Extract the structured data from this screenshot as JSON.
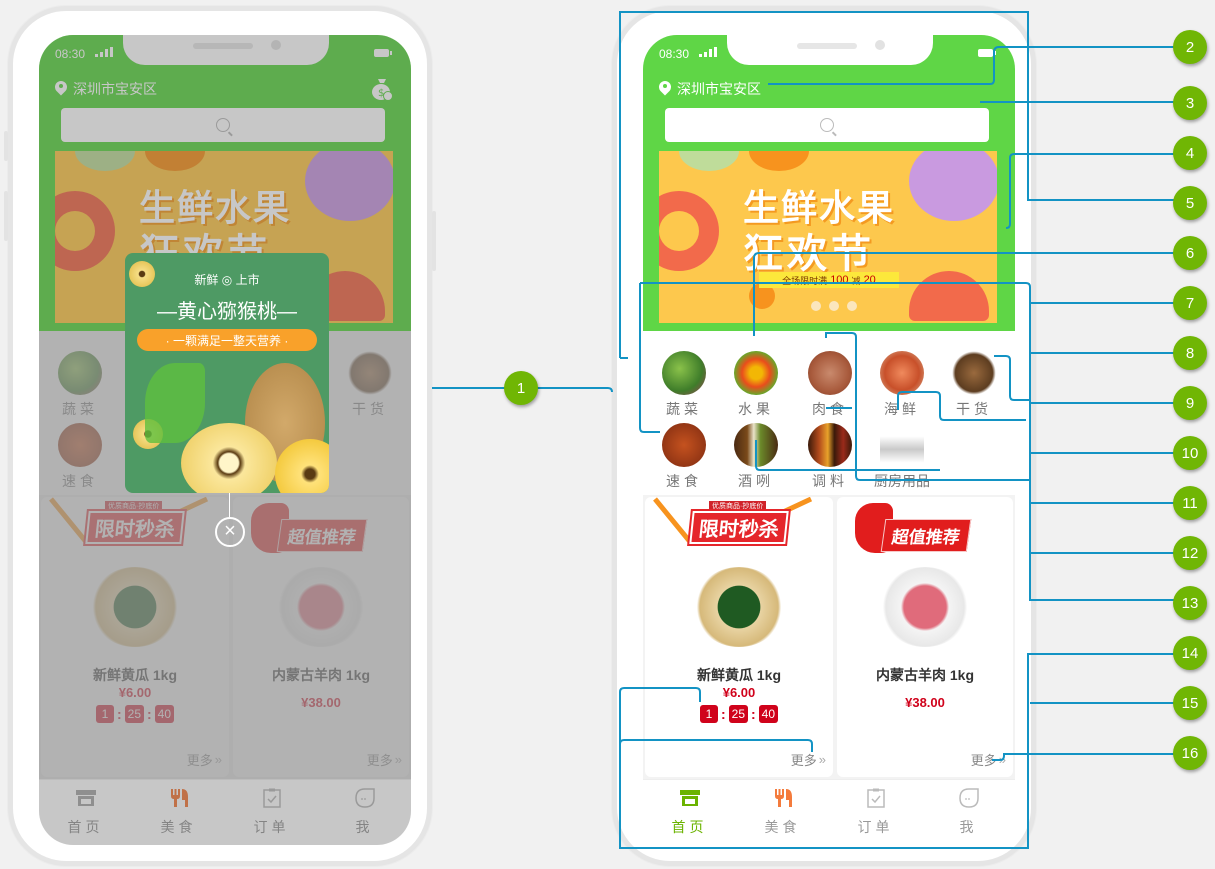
{
  "status_bar": {
    "time": "08:30"
  },
  "header": {
    "location": "深圳市宝安区",
    "search_placeholder": ""
  },
  "banner": {
    "title_line1": "生鲜水果",
    "title_line2": "狂欢节",
    "promo_prefix": "全场限时满",
    "promo_amount1": "100",
    "promo_mid": "减",
    "promo_amount2": "20",
    "slide_count": 3
  },
  "categories": [
    {
      "label": "蔬菜",
      "icon": "vegetables-icon"
    },
    {
      "label": "水果",
      "icon": "fruits-icon"
    },
    {
      "label": "肉食",
      "icon": "meat-icon"
    },
    {
      "label": "海鲜",
      "icon": "seafood-icon"
    },
    {
      "label": "干货",
      "icon": "dried-goods-icon"
    },
    {
      "label": "速食",
      "icon": "fast-food-icon"
    },
    {
      "label": "酒咧",
      "icon": "liquor-icon"
    },
    {
      "label": "调料",
      "icon": "seasoning-icon"
    },
    {
      "label": "厨房用品",
      "icon": "kitchenware-icon"
    }
  ],
  "cards": [
    {
      "badge": "限时秒杀",
      "badge_ribbon": "优质商品·抄底价",
      "product": "新鲜黄瓜  1kg",
      "price": "¥6.00",
      "countdown": {
        "hours": "1",
        "minutes": "25",
        "seconds": "40"
      },
      "more": "更多"
    },
    {
      "badge": "超值推荐",
      "product": "内蒙古羊肉  1kg",
      "price": "¥38.00",
      "more": "更多"
    }
  ],
  "tabbar": [
    {
      "label": "首页",
      "icon": "store-icon",
      "active": true
    },
    {
      "label": "美食",
      "icon": "fork-knife-icon",
      "active": false
    },
    {
      "label": "订单",
      "icon": "clipboard-check-icon",
      "active": false
    },
    {
      "label": "我",
      "icon": "profile-icon",
      "active": false
    }
  ],
  "popup": {
    "subtitle_left": "新鲜",
    "subtitle_right": "上市",
    "title": "—黄心猕猴桃—",
    "tagline": "· 一颗满足一整天营养 ·",
    "close_icon": "close-circle-icon"
  },
  "annotations": [
    "1",
    "2",
    "3",
    "4",
    "5",
    "6",
    "7",
    "8",
    "9",
    "10",
    "11",
    "12",
    "13",
    "14",
    "15",
    "16"
  ],
  "colors": {
    "brand_green": "#5fd646",
    "marker_green": "#70b604",
    "connector_blue": "#1393c4",
    "price_red": "#d0021b",
    "tab_active": "#6bb300",
    "banner_yellow": "#fdc84d"
  }
}
